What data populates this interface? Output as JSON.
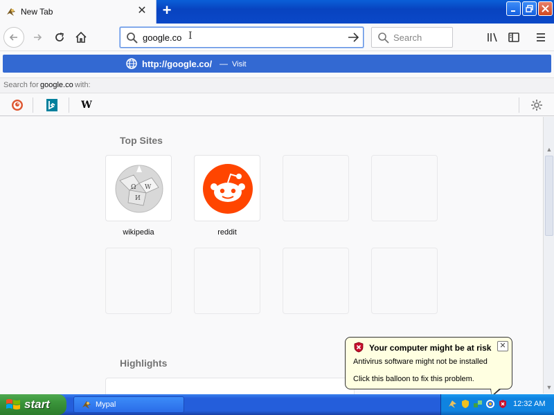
{
  "browser": {
    "tab_title": "New Tab",
    "url_value": "google.co",
    "search_placeholder": "Search"
  },
  "suggestion": {
    "url": "http://google.co/",
    "dash": "—",
    "visit_label": "Visit"
  },
  "search_with": {
    "prefix": "Search for",
    "term": "google.co",
    "suffix": "with:"
  },
  "engines": [
    {
      "name": "duckduckgo",
      "icon": "duckduckgo-icon"
    },
    {
      "name": "bing",
      "icon": "bing-icon"
    },
    {
      "name": "wikipedia",
      "icon": "wikipedia-w-icon",
      "glyph": "W"
    }
  ],
  "newtab": {
    "top_sites_title": "Top Sites",
    "highlights_title": "Highlights",
    "top_sites": [
      {
        "label": "wikipedia",
        "icon": "wikipedia-globe-icon"
      },
      {
        "label": "reddit",
        "icon": "reddit-icon"
      }
    ]
  },
  "balloon": {
    "title": "Your computer might be at risk",
    "line1": "Antivirus software might not be installed",
    "line2": "Click this balloon to fix this problem.",
    "close": "✕"
  },
  "taskbar": {
    "start_label": "start",
    "window_label": "Mypal",
    "time": "12:32 AM"
  },
  "colors": {
    "accent": "#3369d2",
    "reddit": "#ff4500",
    "taskbar": "#245edb",
    "start": "#3a943a",
    "balloon_bg": "#ffffe1"
  }
}
